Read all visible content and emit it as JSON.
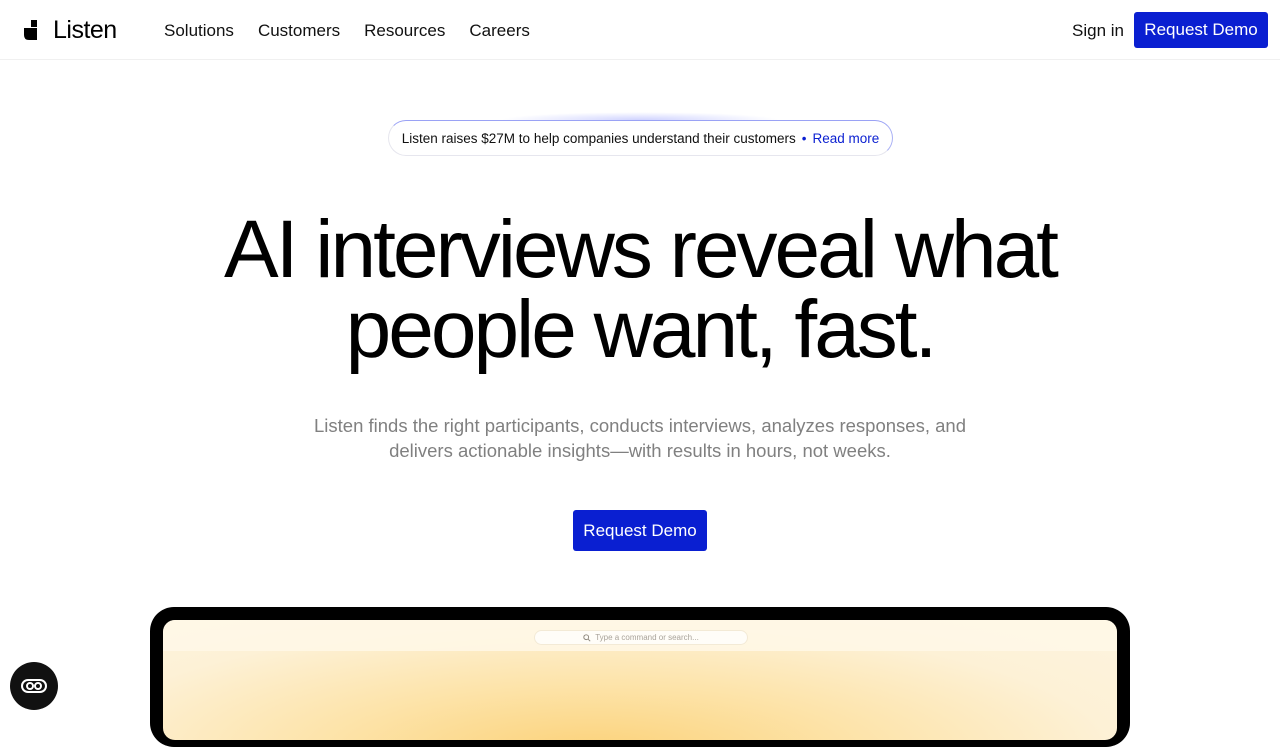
{
  "header": {
    "logo_text": "Listen",
    "nav": [
      {
        "label": "Solutions"
      },
      {
        "label": "Customers"
      },
      {
        "label": "Resources"
      },
      {
        "label": "Careers"
      }
    ],
    "signin_label": "Sign in",
    "demo_label": "Request Demo"
  },
  "announcement": {
    "text": "Listen raises $27M to help companies understand their customers",
    "separator": "•",
    "link_label": "Read more"
  },
  "hero": {
    "title_line1": "AI interviews reveal what",
    "title_line2": "people want, fast.",
    "subtitle_line1": "Listen finds the right participants, conducts interviews, analyzes responses, and",
    "subtitle_line2": "delivers actionable insights—with results in hours, not weeks.",
    "cta_label": "Request Demo"
  },
  "preview": {
    "search_placeholder": "Type a command or search..."
  },
  "floating": {
    "icon": "accessibility-toggle-icon"
  },
  "colors": {
    "accent": "#0a1fd1",
    "text": "#000000",
    "muted": "#808080",
    "device_frame": "#000000",
    "screen_glow": "#fbd27a"
  }
}
